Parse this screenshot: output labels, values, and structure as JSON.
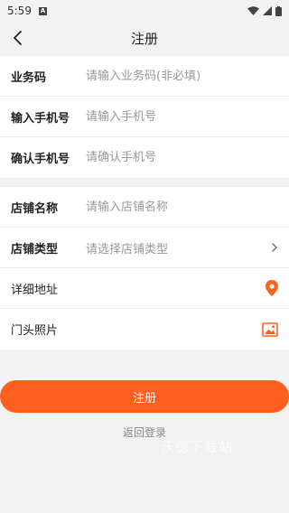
{
  "status_bar": {
    "time": "5:59",
    "notification_glyph": "A"
  },
  "header": {
    "title": "注册"
  },
  "form": {
    "business_code": {
      "label": "业务码",
      "placeholder": "请输入业务码(非必填)"
    },
    "phone": {
      "label": "输入手机号",
      "placeholder": "请输入手机号"
    },
    "confirm_phone": {
      "label": "确认手机号",
      "placeholder": "请确认手机号"
    },
    "store_name": {
      "label": "店铺名称",
      "placeholder": "请输入店铺名称"
    },
    "store_type": {
      "label": "店铺类型",
      "placeholder": "请选择店铺类型"
    },
    "address": {
      "label": "详细地址"
    },
    "storefront_photo": {
      "label": "门头照片"
    }
  },
  "actions": {
    "register_label": "注册",
    "back_to_login": "返回登录"
  },
  "watermark": "沃德下载站",
  "colors": {
    "accent": "#ff6020",
    "background": "#f2f2f2"
  },
  "icons": {
    "back": "chevron-left-icon",
    "chevron": "chevron-right-icon",
    "location": "location-pin-icon",
    "image": "image-icon"
  }
}
